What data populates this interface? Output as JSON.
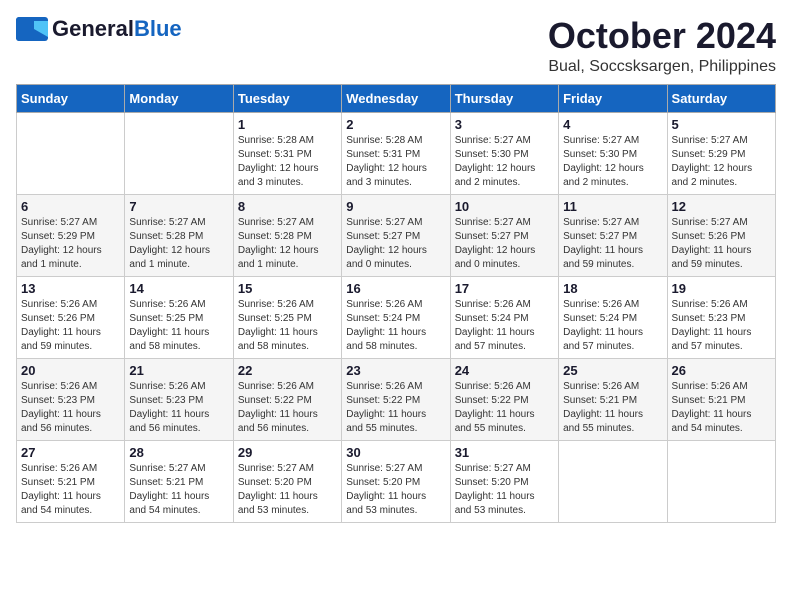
{
  "header": {
    "logo_general": "General",
    "logo_blue": "Blue",
    "month_title": "October 2024",
    "location": "Bual, Soccsksargen, Philippines"
  },
  "days_of_week": [
    "Sunday",
    "Monday",
    "Tuesday",
    "Wednesday",
    "Thursday",
    "Friday",
    "Saturday"
  ],
  "weeks": [
    [
      {
        "day": "",
        "info": ""
      },
      {
        "day": "",
        "info": ""
      },
      {
        "day": "1",
        "info": "Sunrise: 5:28 AM\nSunset: 5:31 PM\nDaylight: 12 hours\nand 3 minutes."
      },
      {
        "day": "2",
        "info": "Sunrise: 5:28 AM\nSunset: 5:31 PM\nDaylight: 12 hours\nand 3 minutes."
      },
      {
        "day": "3",
        "info": "Sunrise: 5:27 AM\nSunset: 5:30 PM\nDaylight: 12 hours\nand 2 minutes."
      },
      {
        "day": "4",
        "info": "Sunrise: 5:27 AM\nSunset: 5:30 PM\nDaylight: 12 hours\nand 2 minutes."
      },
      {
        "day": "5",
        "info": "Sunrise: 5:27 AM\nSunset: 5:29 PM\nDaylight: 12 hours\nand 2 minutes."
      }
    ],
    [
      {
        "day": "6",
        "info": "Sunrise: 5:27 AM\nSunset: 5:29 PM\nDaylight: 12 hours\nand 1 minute."
      },
      {
        "day": "7",
        "info": "Sunrise: 5:27 AM\nSunset: 5:28 PM\nDaylight: 12 hours\nand 1 minute."
      },
      {
        "day": "8",
        "info": "Sunrise: 5:27 AM\nSunset: 5:28 PM\nDaylight: 12 hours\nand 1 minute."
      },
      {
        "day": "9",
        "info": "Sunrise: 5:27 AM\nSunset: 5:27 PM\nDaylight: 12 hours\nand 0 minutes."
      },
      {
        "day": "10",
        "info": "Sunrise: 5:27 AM\nSunset: 5:27 PM\nDaylight: 12 hours\nand 0 minutes."
      },
      {
        "day": "11",
        "info": "Sunrise: 5:27 AM\nSunset: 5:27 PM\nDaylight: 11 hours\nand 59 minutes."
      },
      {
        "day": "12",
        "info": "Sunrise: 5:27 AM\nSunset: 5:26 PM\nDaylight: 11 hours\nand 59 minutes."
      }
    ],
    [
      {
        "day": "13",
        "info": "Sunrise: 5:26 AM\nSunset: 5:26 PM\nDaylight: 11 hours\nand 59 minutes."
      },
      {
        "day": "14",
        "info": "Sunrise: 5:26 AM\nSunset: 5:25 PM\nDaylight: 11 hours\nand 58 minutes."
      },
      {
        "day": "15",
        "info": "Sunrise: 5:26 AM\nSunset: 5:25 PM\nDaylight: 11 hours\nand 58 minutes."
      },
      {
        "day": "16",
        "info": "Sunrise: 5:26 AM\nSunset: 5:24 PM\nDaylight: 11 hours\nand 58 minutes."
      },
      {
        "day": "17",
        "info": "Sunrise: 5:26 AM\nSunset: 5:24 PM\nDaylight: 11 hours\nand 57 minutes."
      },
      {
        "day": "18",
        "info": "Sunrise: 5:26 AM\nSunset: 5:24 PM\nDaylight: 11 hours\nand 57 minutes."
      },
      {
        "day": "19",
        "info": "Sunrise: 5:26 AM\nSunset: 5:23 PM\nDaylight: 11 hours\nand 57 minutes."
      }
    ],
    [
      {
        "day": "20",
        "info": "Sunrise: 5:26 AM\nSunset: 5:23 PM\nDaylight: 11 hours\nand 56 minutes."
      },
      {
        "day": "21",
        "info": "Sunrise: 5:26 AM\nSunset: 5:23 PM\nDaylight: 11 hours\nand 56 minutes."
      },
      {
        "day": "22",
        "info": "Sunrise: 5:26 AM\nSunset: 5:22 PM\nDaylight: 11 hours\nand 56 minutes."
      },
      {
        "day": "23",
        "info": "Sunrise: 5:26 AM\nSunset: 5:22 PM\nDaylight: 11 hours\nand 55 minutes."
      },
      {
        "day": "24",
        "info": "Sunrise: 5:26 AM\nSunset: 5:22 PM\nDaylight: 11 hours\nand 55 minutes."
      },
      {
        "day": "25",
        "info": "Sunrise: 5:26 AM\nSunset: 5:21 PM\nDaylight: 11 hours\nand 55 minutes."
      },
      {
        "day": "26",
        "info": "Sunrise: 5:26 AM\nSunset: 5:21 PM\nDaylight: 11 hours\nand 54 minutes."
      }
    ],
    [
      {
        "day": "27",
        "info": "Sunrise: 5:26 AM\nSunset: 5:21 PM\nDaylight: 11 hours\nand 54 minutes."
      },
      {
        "day": "28",
        "info": "Sunrise: 5:27 AM\nSunset: 5:21 PM\nDaylight: 11 hours\nand 54 minutes."
      },
      {
        "day": "29",
        "info": "Sunrise: 5:27 AM\nSunset: 5:20 PM\nDaylight: 11 hours\nand 53 minutes."
      },
      {
        "day": "30",
        "info": "Sunrise: 5:27 AM\nSunset: 5:20 PM\nDaylight: 11 hours\nand 53 minutes."
      },
      {
        "day": "31",
        "info": "Sunrise: 5:27 AM\nSunset: 5:20 PM\nDaylight: 11 hours\nand 53 minutes."
      },
      {
        "day": "",
        "info": ""
      },
      {
        "day": "",
        "info": ""
      }
    ]
  ]
}
